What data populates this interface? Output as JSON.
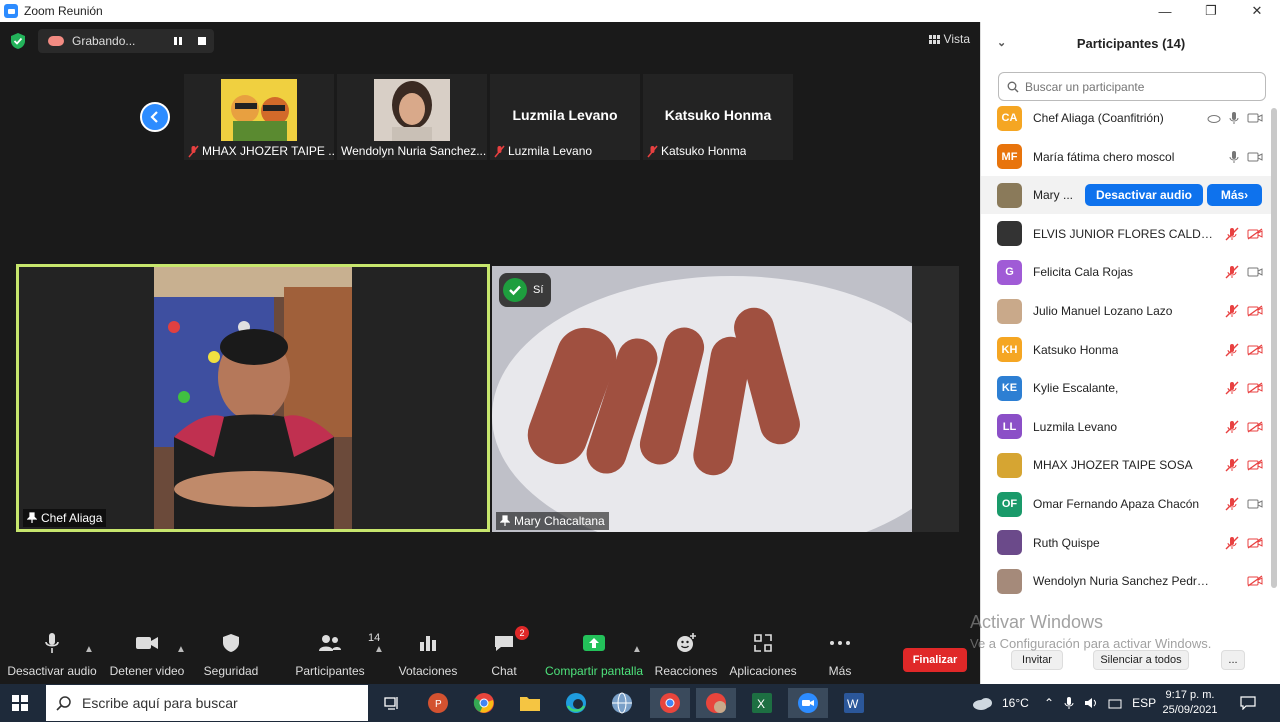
{
  "window": {
    "title": "Zoom Reunión"
  },
  "topbar": {
    "recording_label": "Grabando...",
    "view_label": "Vista"
  },
  "gallery": {
    "thumbs": [
      {
        "name": "MHAX JHOZER TAIPE ...",
        "big": ""
      },
      {
        "name": "Wendolyn Nuria Sanchez...",
        "big": ""
      },
      {
        "name": "Luzmila Levano",
        "big": "Luzmila Levano"
      },
      {
        "name": "Katsuko Honma",
        "big": "Katsuko Honma"
      }
    ],
    "tiles": [
      {
        "name": "Chef Aliaga"
      },
      {
        "name": "Mary Chacaltana",
        "badge": "Sí"
      }
    ]
  },
  "toolbar": {
    "mute": "Desactivar audio",
    "video": "Detener video",
    "security": "Seguridad",
    "participants": "Participantes",
    "participants_count": "14",
    "polls": "Votaciones",
    "chat": "Chat",
    "chat_badge": "2",
    "share": "Compartir pantalla",
    "reactions": "Reacciones",
    "apps": "Aplicaciones",
    "more": "Más",
    "end": "Finalizar"
  },
  "panel": {
    "title": "Participantes (14)",
    "search_placeholder": "Buscar un participante",
    "mute_btn": "Desactivar audio",
    "more_btn": "Más",
    "participants": [
      {
        "initials": "CA",
        "name": "Chef Aliaga (Coanfitrión)",
        "color": "#f5a623",
        "mic": "on",
        "cam": "on"
      },
      {
        "initials": "MF",
        "name": "María fátima  chero moscol",
        "color": "#e8740c",
        "mic": "on",
        "cam": "on"
      },
      {
        "initials": "",
        "name": "Mary ...",
        "color": "#8a7a5a",
        "mic": "hover",
        "cam": "hover"
      },
      {
        "initials": "",
        "name": "ELVIS JUNIOR FLORES CALDER...",
        "color": "#333333",
        "mic": "off",
        "cam": "off"
      },
      {
        "initials": "G",
        "name": "Felicita Cala Rojas",
        "color": "#a05bd6",
        "mic": "off",
        "cam": "on"
      },
      {
        "initials": "",
        "name": "Julio Manuel Lozano Lazo",
        "color": "#c9a98a",
        "mic": "off",
        "cam": "off"
      },
      {
        "initials": "KH",
        "name": "Katsuko Honma",
        "color": "#f5a623",
        "mic": "off",
        "cam": "off"
      },
      {
        "initials": "KE",
        "name": "Kylie  Escalante,",
        "color": "#2d7fd3",
        "mic": "off",
        "cam": "off"
      },
      {
        "initials": "LL",
        "name": "Luzmila Levano",
        "color": "#8b4fc7",
        "mic": "off",
        "cam": "off"
      },
      {
        "initials": "",
        "name": "MHAX JHOZER TAIPE SOSA",
        "color": "#d6a532",
        "mic": "off",
        "cam": "off"
      },
      {
        "initials": "OF",
        "name": "Omar Fernando Apaza Chacón",
        "color": "#1a9a6a",
        "mic": "off",
        "cam": "on"
      },
      {
        "initials": "",
        "name": "Ruth Quispe",
        "color": "#6b4a8a",
        "mic": "off",
        "cam": "off"
      },
      {
        "initials": "",
        "name": "Wendolyn Nuria Sanchez Pedraza",
        "color": "#a58a7a",
        "mic": "none",
        "cam": "off"
      }
    ],
    "invite": "Invitar",
    "mute_all": "Silenciar a todos",
    "more_dots": "..."
  },
  "watermark": {
    "line1": "Activar Windows",
    "line2": "Ve a Configuración para activar Windows."
  },
  "taskbar": {
    "search_placeholder": "Escribe aquí para buscar",
    "temp": "16°C",
    "lang": "ESP",
    "time": "9:17 p. m.",
    "date": "25/09/2021"
  }
}
